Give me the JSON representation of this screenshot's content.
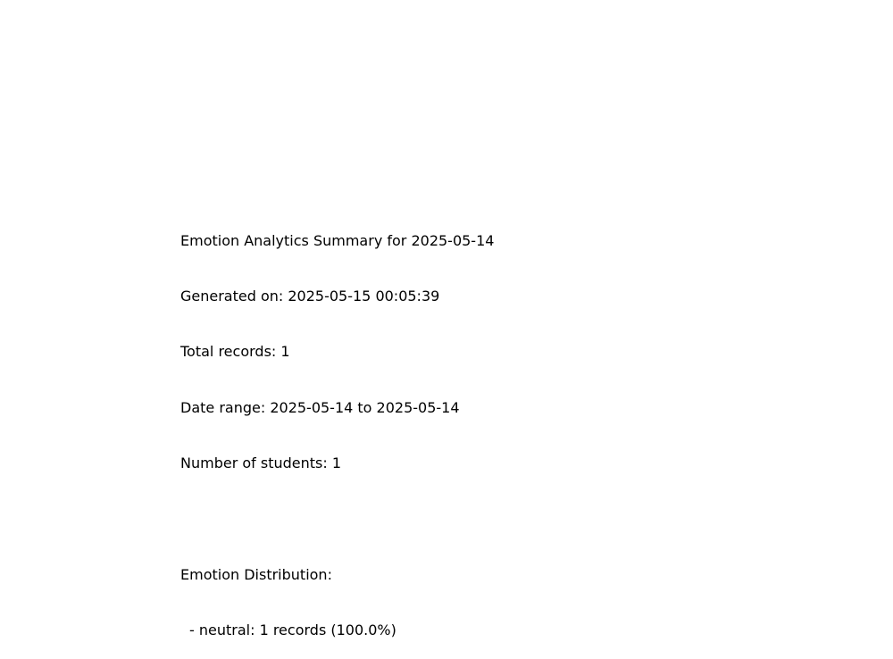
{
  "summary": {
    "title": "Emotion Analytics Summary for 2025-05-14",
    "generated": "Generated on: 2025-05-15 00:05:39",
    "total_records": "Total records: 1",
    "date_range": "Date range: 2025-05-14 to 2025-05-14",
    "students": "Number of students: 1",
    "distribution_heading": "Emotion Distribution:",
    "distribution_items": [
      "- neutral: 1 records (100.0%)"
    ]
  }
}
